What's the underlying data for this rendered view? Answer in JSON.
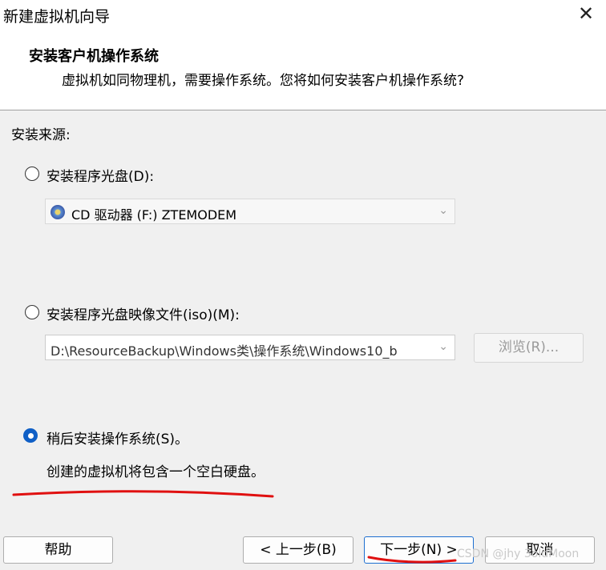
{
  "window": {
    "title": "新建虚拟机向导",
    "close_icon": "✕"
  },
  "header": {
    "title": "安装客户机操作系统",
    "subtitle": "虚拟机如同物理机，需要操作系统。您将如何安装客户机操作系统?"
  },
  "source": {
    "label": "安装来源:",
    "options": [
      {
        "label": "安装程序光盘(D):",
        "selected": false
      },
      {
        "label": "安装程序光盘映像文件(iso)(M):",
        "selected": false
      },
      {
        "label": "稍后安装操作系统(S)。",
        "selected": true
      }
    ],
    "cd_drive": {
      "value": "CD 驱动器 (F:) ZTEMODEM",
      "icon": "cd-drive-icon"
    },
    "iso_path": {
      "value": "D:\\ResourceBackup\\Windows类\\操作系统\\Windows10_b"
    },
    "browse_label": "浏览(R)...",
    "later_note": "创建的虚拟机将包含一个空白硬盘。"
  },
  "buttons": {
    "help": "帮助",
    "back": "< 上一步(B)",
    "next": "下一步(N) >",
    "cancel": "取消"
  },
  "watermark": "CSDN @jhy 3oldMoon",
  "colors": {
    "accent": "#0f5fc6",
    "annotation": "#e01010"
  }
}
